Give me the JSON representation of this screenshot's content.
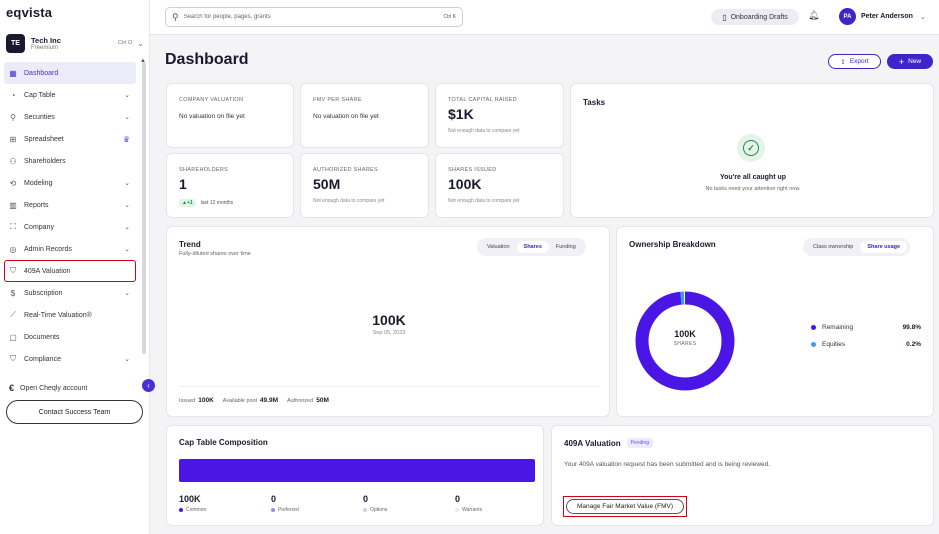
{
  "app": {
    "logo": "eqvista"
  },
  "company": {
    "initials": "TE",
    "name": "Tech Inc",
    "plan": "Freemium",
    "shortcut": "Ctrl O"
  },
  "sidebar": {
    "items": [
      {
        "label": "Dashboard",
        "icon": "dashboard-icon",
        "glyph": "▦"
      },
      {
        "label": "Cap Table",
        "icon": "pie-icon",
        "glyph": "◔"
      },
      {
        "label": "Securities",
        "icon": "securities-icon",
        "glyph": "⚲"
      },
      {
        "label": "Spreadsheet",
        "icon": "spreadsheet-icon",
        "glyph": "⊞"
      },
      {
        "label": "Shareholders",
        "icon": "users-icon",
        "glyph": "⚇"
      },
      {
        "label": "Modeling",
        "icon": "modeling-icon",
        "glyph": "⟲"
      },
      {
        "label": "Reports",
        "icon": "reports-icon",
        "glyph": "▥"
      },
      {
        "label": "Company",
        "icon": "company-icon",
        "glyph": "⛶"
      },
      {
        "label": "Admin Records",
        "icon": "records-icon",
        "glyph": "◎"
      },
      {
        "label": "409A Valuation",
        "icon": "shield-icon",
        "glyph": "⛉"
      },
      {
        "label": "Subscription",
        "icon": "subscription-icon",
        "glyph": "$"
      },
      {
        "label": "Real-Time Valuation®",
        "icon": "trend-icon",
        "glyph": "⟋"
      },
      {
        "label": "Documents",
        "icon": "documents-icon",
        "glyph": "▢"
      },
      {
        "label": "Compliance",
        "icon": "compliance-icon",
        "glyph": "⛉"
      }
    ],
    "cheqly": "Open Cheqly account",
    "contact": "Contact Success Team"
  },
  "header": {
    "search_placeholder": "Search for people, pages, grants",
    "search_shortcut": "Ctrl K",
    "drafts": "Onboarding Drafts",
    "user_initials": "PA",
    "user_name": "Peter Anderson"
  },
  "main": {
    "title": "Dashboard",
    "export": "Export",
    "new": "New",
    "stats": {
      "company_valuation": {
        "label": "COMPANY VALUATION",
        "value": "No valuation on file yet"
      },
      "fmv": {
        "label": "FMV PER SHARE",
        "value": "No valuation on file yet"
      },
      "capital": {
        "label": "TOTAL CAPITAL RAISED",
        "value": "$1K",
        "note": "Not enough data to compare yet"
      },
      "shareholders": {
        "label": "SHAREHOLDERS",
        "value": "1",
        "delta": "▲+1",
        "delta_note": "last 12 months"
      },
      "authorized": {
        "label": "AUTHORIZED SHARES",
        "value": "50M",
        "note": "Not enough data to compare yet"
      },
      "issued": {
        "label": "SHARES ISSUED",
        "value": "100K",
        "note": "Not enough data to compare yet"
      }
    },
    "tasks": {
      "title": "Tasks",
      "heading": "You're all caught up",
      "sub": "No tasks need your attention right now."
    },
    "trend": {
      "title": "Trend",
      "sub": "Fully-diluted shares over time",
      "tabs": [
        "Valuation",
        "Shares",
        "Funding"
      ],
      "value": "100K",
      "date": "Sep 05, 2023",
      "issued_label": "Issued",
      "issued": "100K",
      "pool_label": "Available pool",
      "pool": "49.9M",
      "authorized_label": "Authorized",
      "authorized": "50M"
    },
    "ownership": {
      "title": "Ownership Breakdown",
      "tabs": [
        "Class ownership",
        "Share usage"
      ],
      "center_value": "100K",
      "center_unit": "SHARES",
      "slices": [
        {
          "name": "Remaining",
          "pct": "99.8%",
          "value": 99.8,
          "color": "#4a16e6"
        },
        {
          "name": "Equities",
          "pct": "0.2%",
          "value": 0.2,
          "color": "#3b9cf5"
        }
      ]
    },
    "cap_table": {
      "title": "Cap Table Composition",
      "items": [
        {
          "value": "100K",
          "label": "Common",
          "color": "#4a16e6"
        },
        {
          "value": "0",
          "label": "Preferred",
          "color": "#9a8ce8"
        },
        {
          "value": "0",
          "label": "Options",
          "color": "#cfcfe0"
        },
        {
          "value": "0",
          "label": "Warrants",
          "color": "#e8e8f0"
        }
      ]
    },
    "valuation": {
      "title": "409A Valuation",
      "status": "Pending",
      "desc": "Your 409A valuation request has been submitted and is being reviewed.",
      "button": "Manage Fair Market Value (FMV)"
    }
  }
}
